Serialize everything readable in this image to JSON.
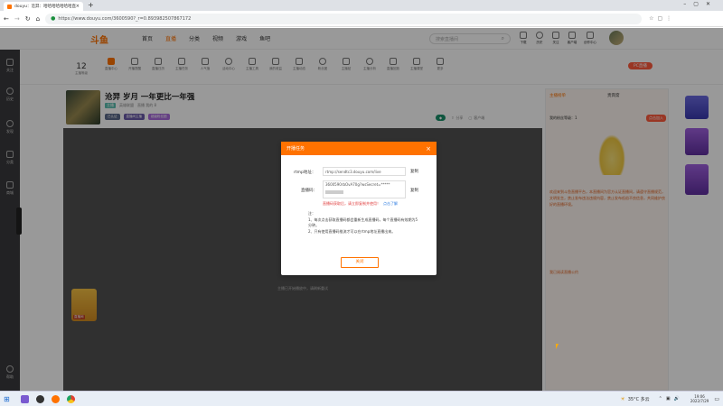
{
  "browser": {
    "tab_title": "douyu：沧羿：哈哈哈哈哈哈哈直播",
    "url": "https://www.douyu.com/3600590?_r=0.893982507867172"
  },
  "site": {
    "logo": "斗鱼",
    "nav": [
      "首页",
      "直播",
      "分类",
      "视频",
      "游戏",
      "鱼吧"
    ],
    "search_placeholder": "搜索直播间",
    "user_actions": [
      "下载",
      "历史",
      "关注",
      "客户端",
      "创作中心"
    ]
  },
  "toolbar": {
    "level_number": "12",
    "items": [
      "主播等级",
      "直播中心",
      "开播提醒",
      "直播日历",
      "主播任务",
      "人气值",
      "活动中心",
      "主播工具",
      "我的收益",
      "主播动态",
      "粉丝团",
      "主播贴",
      "主播分析",
      "直播回放",
      "主播课堂",
      "更多"
    ],
    "pc_live_label": "PC直播"
  },
  "sidebar": {
    "items": [
      "关注",
      "历史",
      "发现",
      "分类",
      "商城"
    ],
    "bottom": "帮助"
  },
  "room": {
    "title": "沧羿 岁月 一年更比一年强",
    "meta_tag": "主播",
    "category": "英雄联盟",
    "stats": "直播 我的 8",
    "tags": [
      "已认证",
      "直播间主播",
      "超级粉丝团"
    ],
    "share_label": "分享",
    "report_label": "客户端",
    "player_msg": "主播已开始播放中，请刷新重试",
    "gift_banner": "直播间"
  },
  "chat": {
    "tab_rank": "主播榜单",
    "tab_fans": "贵宾席",
    "notice": "我的粉丝等级：1",
    "send_label": "点击加入",
    "system_msg": "欢迎来到斗鱼直播平台，本直播间为官方认证直播间，请遵守直播规范，文明发言，禁止发布违法违规内容，禁止发布低俗不良信息，共同维护良好的直播环境。",
    "system_link": "我已阅读直播公约"
  },
  "modal": {
    "title": "开播任务",
    "rtmp_label": "rtmp地址：",
    "rtmp_value": "rtmp://sendtc3.douyu.com/live",
    "code_label": "直播码：",
    "code_value": "3600590rbOvA70g?wsSecret=*****",
    "copy_label": "复制",
    "warning": "直播码获取后，请立即复制并使用！",
    "help_link": "点击了解",
    "note_title": "注：",
    "notes": [
      "1、每次点击获取直播码都会重新生成直播码，每个直播码有效期为5分钟。",
      "2、只有使用直播码推流才可以在rtmp地址直播出来。"
    ],
    "close_label": "关闭"
  },
  "taskbar": {
    "weather": "35°C 多云",
    "time": "19:06",
    "date": "2022/7/29"
  }
}
